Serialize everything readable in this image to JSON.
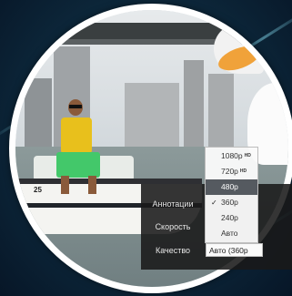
{
  "video": {
    "boat_number": "25"
  },
  "settings_menu": {
    "annotations_label": "Аннотации",
    "speed_label": "Скорость",
    "quality_label": "Качество",
    "quality_value": "Авто (360p"
  },
  "quality_options": [
    {
      "label": "1080p",
      "hd": "HD"
    },
    {
      "label": "720p",
      "hd": "HD"
    },
    {
      "label": "480p",
      "hd": ""
    },
    {
      "label": "360p",
      "hd": ""
    },
    {
      "label": "240p",
      "hd": ""
    },
    {
      "label": "Авто",
      "hd": ""
    }
  ],
  "quality_checked": "360p",
  "quality_highlighted": "480p",
  "colors": {
    "background": "#0e2c40",
    "frame": "#ffffff",
    "menu_panel": "#191919",
    "highlight": "#555a60"
  }
}
